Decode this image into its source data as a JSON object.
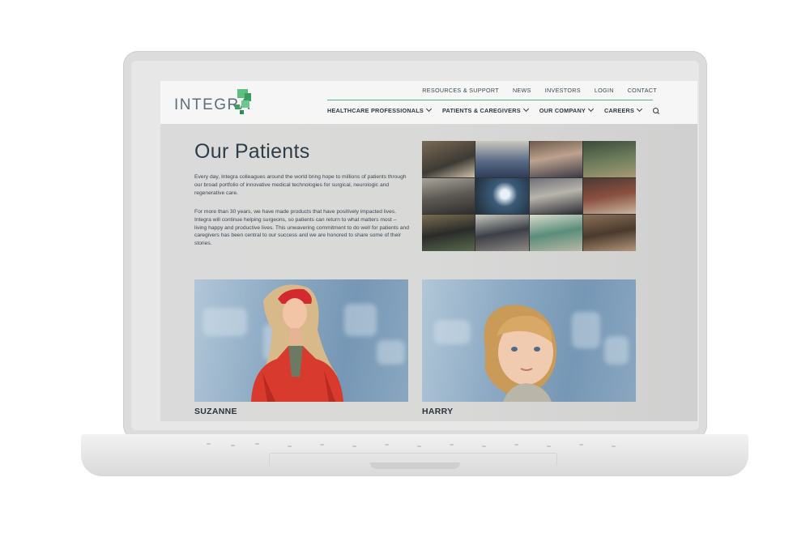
{
  "brand": {
    "name": "INTEGRA",
    "accent": "#55b37a"
  },
  "utility_nav": [
    "RESOURCES & SUPPORT",
    "NEWS",
    "INVESTORS",
    "LOGIN",
    "CONTACT"
  ],
  "main_nav": [
    {
      "label": "HEALTHCARE PROFESSIONALS"
    },
    {
      "label": "PATIENTS & CAREGIVERS"
    },
    {
      "label": "OUR COMPANY"
    },
    {
      "label": "CAREERS"
    }
  ],
  "page": {
    "title": "Our Patients",
    "intro_p1": "Every day, Integra colleagues around the world bring hope to millions of patients through our broad portfolio of innovative medical technologies for surgical, neurologic and regenerative care.",
    "intro_p2": "For more than 30 years, we have made products that have positively impacted lives. Integra will continue helping surgeons, so patients can return to what matters most – living happy and productive lives. This unwavering commitment to do well for patients and caregivers has been central to our success and we are honored to share some of their stories."
  },
  "patients": [
    {
      "name": "SUZANNE"
    },
    {
      "name": "HARRY"
    }
  ]
}
